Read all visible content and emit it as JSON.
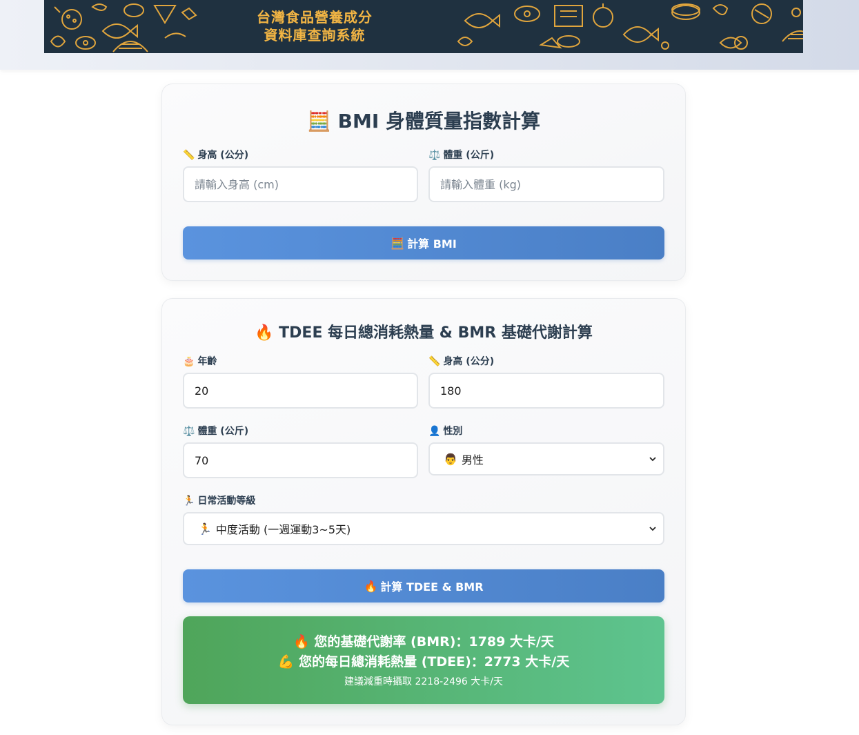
{
  "header": {
    "title_line1": "台灣食品營養成分",
    "title_line2": "資料庫查詢系統"
  },
  "bmi": {
    "title_icon": "🧮",
    "title": "BMI 身體質量指數計算",
    "height_icon": "📏",
    "height_label": "身高 (公分)",
    "height_placeholder": "請輸入身高 (cm)",
    "weight_icon": "⚖️",
    "weight_label": "體重 (公斤)",
    "weight_placeholder": "請輸入體重 (kg)",
    "button_icon": "🧮",
    "button_label": "計算 BMI"
  },
  "tdee": {
    "title_icon": "🔥",
    "title": "TDEE 每日總消耗熱量 & BMR 基礎代謝計算",
    "age_icon": "🎂",
    "age_label": "年齡",
    "age_value": "20",
    "height_icon": "📏",
    "height_label": "身高 (公分)",
    "height_value": "180",
    "weight_icon": "⚖️",
    "weight_label": "體重 (公斤)",
    "weight_value": "70",
    "gender_icon": "👤",
    "gender_label": "性別",
    "gender_selected_icon": "👨",
    "gender_selected": "男性",
    "activity_icon": "🏃",
    "activity_label": "日常活動等級",
    "activity_selected_icon": "🏃",
    "activity_selected": "中度活動 (一週運動3~5天)",
    "button_icon": "🔥",
    "button_label": "計算 TDEE & BMR"
  },
  "result": {
    "bmr_icon": "🔥",
    "bmr_text": "您的基礎代謝率 (BMR)：1789 大卡/天",
    "tdee_icon": "💪",
    "tdee_text": "您的每日總消耗熱量 (TDEE)：2773 大卡/天",
    "advice_text": "建議減重時攝取 2218-2496 大卡/天"
  },
  "colors": {
    "banner_bg": "#1f3140",
    "banner_text": "#f2b544",
    "button_blue": "#4a7fc6",
    "result_green": "#4fa55a"
  }
}
